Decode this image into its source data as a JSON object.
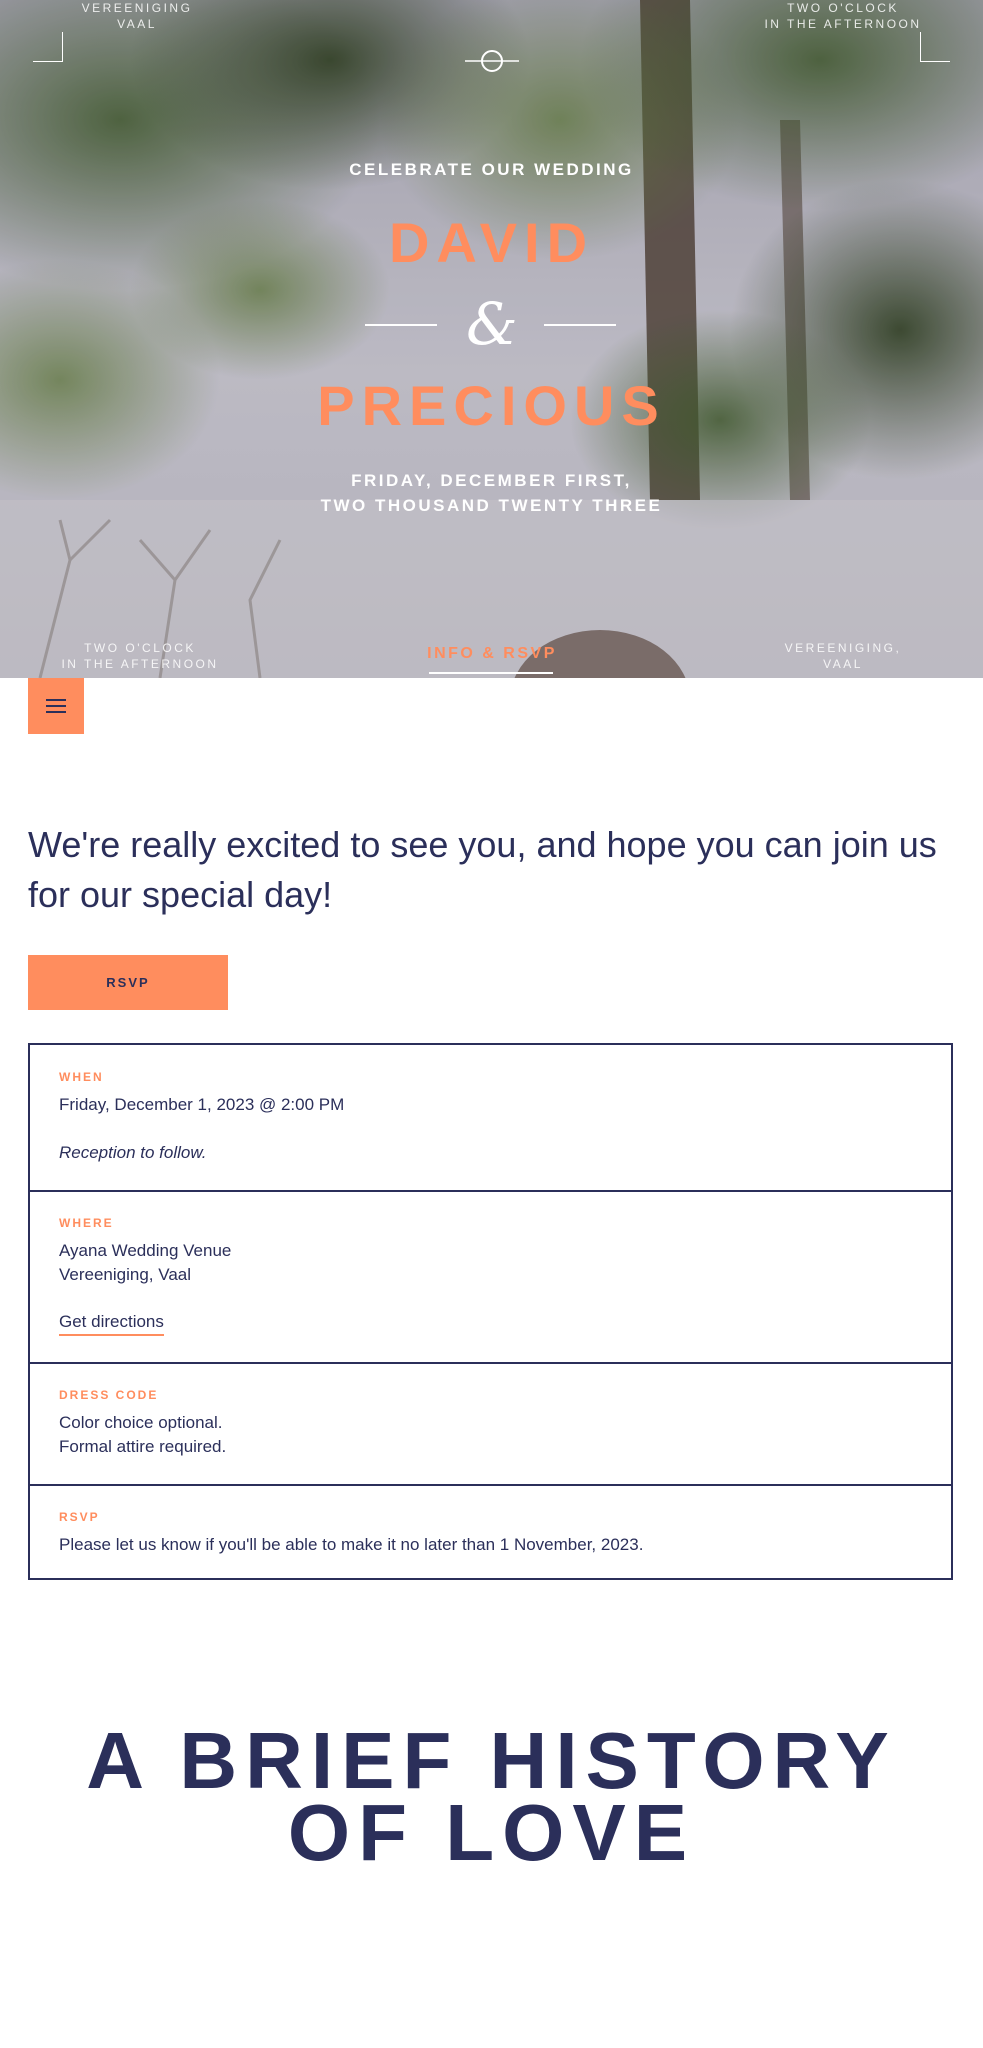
{
  "hero": {
    "top_left_label": "VEREENIGING\nVAAL",
    "top_right_label": "TWO O'CLOCK\nIN THE AFTERNOON",
    "kicker": "CELEBRATE OUR WEDDING",
    "name_first": "DAVID",
    "ampersand": "&",
    "name_second": "PRECIOUS",
    "date_line_1": "FRIDAY, DECEMBER FIRST,",
    "date_line_2": "TWO THOUSAND TWENTY THREE",
    "bottom_left_label_1": "TWO O'CLOCK",
    "bottom_left_label_2": "IN THE AFTERNOON",
    "active_tab": "INFO & RSVP",
    "bottom_right_label_1": "VEREENIGING,",
    "bottom_right_label_2": "VAAL"
  },
  "menu": {
    "icon": "hamburger-menu-icon"
  },
  "intro": {
    "text": "We're really excited to see you, and hope you can join us for our special day!",
    "rsvp_button": "RSVP"
  },
  "details": {
    "when": {
      "label": "WHEN",
      "line1": "Friday, December 1, 2023 @ 2:00 PM",
      "note": "Reception to follow."
    },
    "where": {
      "label": "WHERE",
      "line1": "Ayana Wedding Venue",
      "line2": "Vereeniging, Vaal",
      "link": "Get directions"
    },
    "dress_code": {
      "label": "DRESS CODE",
      "line1": "Color choice optional.",
      "line2": "Formal attire required."
    },
    "rsvp": {
      "label": "RSVP",
      "line1": "Please let us know if you'll be able to make it no later than 1 November, 2023."
    }
  },
  "history": {
    "line1": "A BRIEF HISTORY",
    "line2": "OF LOVE"
  },
  "colors": {
    "accent": "#ff8d5e",
    "navy": "#2b2f5a",
    "white": "#ffffff"
  }
}
